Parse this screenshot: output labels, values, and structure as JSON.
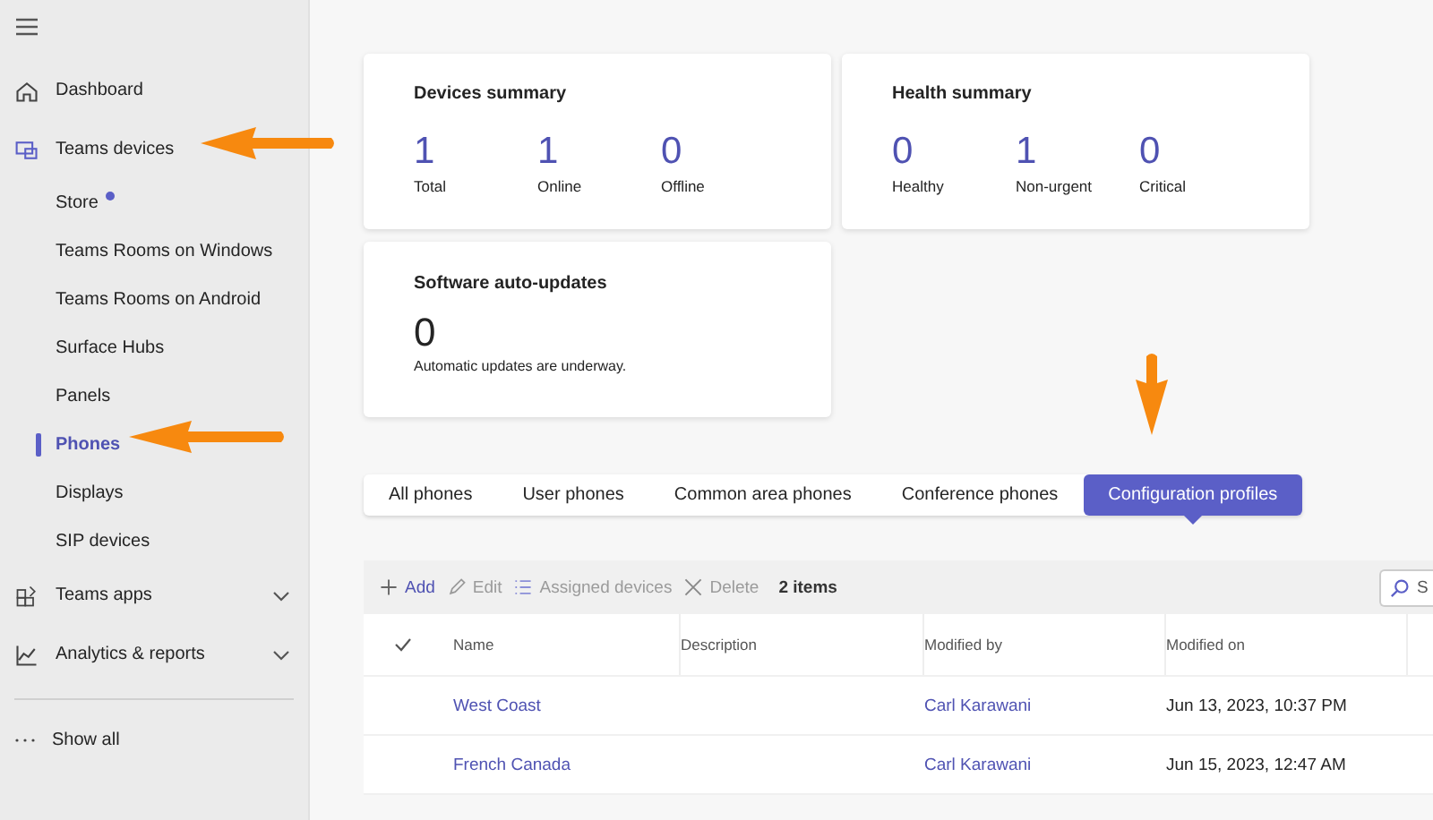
{
  "nav": {
    "items": [
      {
        "label": "Dashboard",
        "selected": false
      },
      {
        "label": "Teams devices",
        "selected": false,
        "expanded": true,
        "children": [
          {
            "label": "Store",
            "selected": false,
            "badge": true
          },
          {
            "label": "Teams Rooms on Windows",
            "selected": false,
            "badge": false
          },
          {
            "label": "Teams Rooms on Android",
            "selected": false,
            "badge": false
          },
          {
            "label": "Surface Hubs",
            "selected": false,
            "badge": false
          },
          {
            "label": "Panels",
            "selected": false,
            "badge": false
          },
          {
            "label": "Phones",
            "selected": true,
            "badge": false
          },
          {
            "label": "Displays",
            "selected": false,
            "badge": false
          },
          {
            "label": "SIP devices",
            "selected": false,
            "badge": false
          }
        ]
      },
      {
        "label": "Teams apps",
        "selected": false,
        "expanded": false
      },
      {
        "label": "Analytics & reports",
        "selected": false,
        "expanded": false
      }
    ],
    "show_all": "Show all"
  },
  "cards": [
    {
      "title": "Devices summary",
      "stats": [
        {
          "value": "1",
          "label": "Total"
        },
        {
          "value": "1",
          "label": "Online"
        },
        {
          "value": "0",
          "label": "Offline"
        }
      ]
    },
    {
      "title": "Health summary",
      "stats": [
        {
          "value": "0",
          "label": "Healthy"
        },
        {
          "value": "1",
          "label": "Non-urgent"
        },
        {
          "value": "0",
          "label": "Critical"
        }
      ]
    }
  ],
  "updates_card": {
    "title": "Software auto-updates",
    "value": "0",
    "note": "Automatic updates are underway."
  },
  "tabs": [
    {
      "label": "All phones",
      "selected": false
    },
    {
      "label": "User phones",
      "selected": false
    },
    {
      "label": "Common area phones",
      "selected": false
    },
    {
      "label": "Conference phones",
      "selected": false
    },
    {
      "label": "Configuration profiles",
      "selected": true
    }
  ],
  "toolbar": {
    "actions": [
      {
        "label": "Add",
        "disabled": false
      },
      {
        "label": "Edit",
        "disabled": true
      },
      {
        "label": "Assigned devices",
        "disabled": true
      },
      {
        "label": "Delete",
        "disabled": true
      }
    ],
    "count": "2 items",
    "search": {
      "placeholder": "S"
    }
  },
  "table": {
    "columns": [
      "Name",
      "Description",
      "Modified by",
      "Modified on"
    ],
    "rows": [
      {
        "name": "West Coast",
        "modified_by": "Carl Karawani",
        "modified_on": "Jun 13, 2023, 10:37 PM"
      },
      {
        "name": "French Canada",
        "modified_by": "Carl Karawani",
        "modified_on": "Jun 15, 2023, 12:47 AM"
      }
    ]
  }
}
